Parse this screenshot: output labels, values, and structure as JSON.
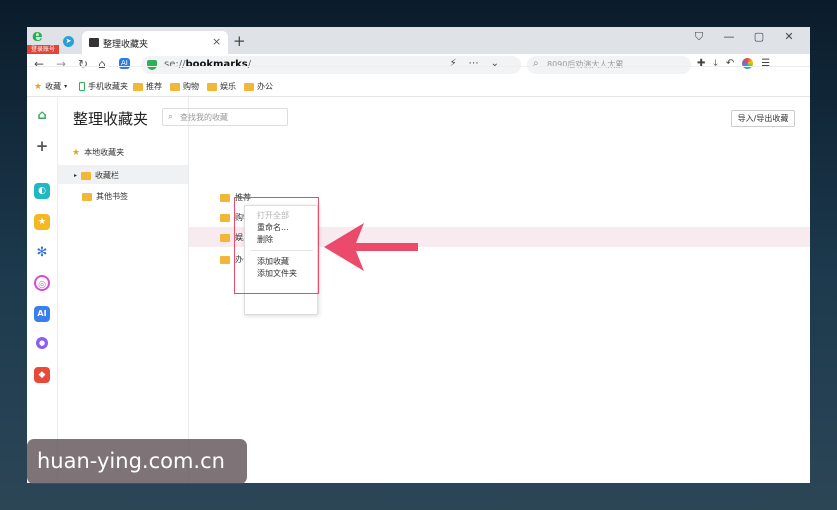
{
  "browser": {
    "logo_badge": "登录账号",
    "tab_title": "整理收藏夹",
    "tab_close": "×",
    "new_tab": "+",
    "window_buttons": [
      "⛉",
      "—",
      "▢",
      "✕"
    ],
    "url_prefix": "se://",
    "url_bold": "bookmarks",
    "url_suffix": "/",
    "search_placeholder": "8090后劝演大人太累",
    "nav": {
      "back": "←",
      "forward": "→",
      "reload": "↻",
      "home": "⌂",
      "ai": "AI"
    }
  },
  "bookmarks_bar": {
    "favorites": "收藏",
    "mobile": "手机收藏夹",
    "items": [
      "推荐",
      "购物",
      "娱乐",
      "办公"
    ]
  },
  "page": {
    "title": "整理收藏夹",
    "search_placeholder": "查找我的收藏",
    "import_export": "导入/导出收藏"
  },
  "tree": {
    "root": "本地收藏夹",
    "items": [
      {
        "label": "收藏栏",
        "selected": true
      },
      {
        "label": "其他书签",
        "selected": false
      }
    ]
  },
  "folders": [
    {
      "label": "推荐"
    },
    {
      "label": "购物"
    },
    {
      "label": "娱乐"
    },
    {
      "label": "办公"
    }
  ],
  "context_menu": {
    "items": [
      {
        "label": "打开全部",
        "disabled": true
      },
      {
        "label": "重命名...",
        "disabled": false
      },
      {
        "label": "删除",
        "disabled": false
      },
      {
        "label": "添加收藏",
        "disabled": false
      },
      {
        "label": "添加文件夹",
        "disabled": false
      }
    ]
  },
  "watermark": "huan-ying.com.cn",
  "colors": {
    "highlight_box": "#ec4a6a",
    "arrow": "#ec4a6a",
    "folder": "#f2b736",
    "row_highlight": "#f7ebf0"
  },
  "icons": {
    "sidebar": [
      "home-icon",
      "add-icon",
      "ai-assistant-icon",
      "favorites-star-icon",
      "network-icon",
      "ai-chat-icon",
      "ai-badge-icon",
      "bot-icon",
      "game-icon"
    ]
  }
}
